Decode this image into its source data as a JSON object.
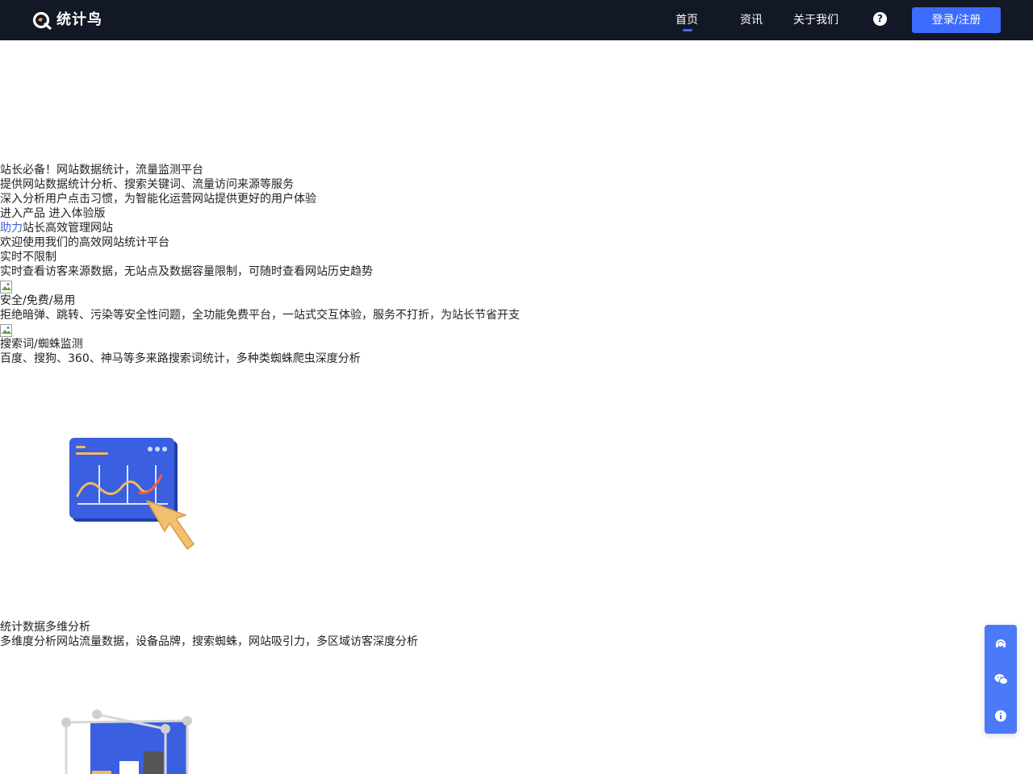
{
  "header": {
    "logo_text": "统计鸟",
    "nav": [
      {
        "label": "首页",
        "active": true
      },
      {
        "label": "资讯",
        "active": false
      },
      {
        "label": "关于我们",
        "active": false
      }
    ],
    "help_icon": "question-circle-icon",
    "help_glyph": "?",
    "login_label": "登录/注册",
    "accent_color": "#3d6bfc",
    "bar_color": "#131826"
  },
  "hero": {
    "title": "站长必备！网站数据统计，流量监测平台",
    "subtitle1": "提供网站数据统计分析、搜索关键词、流量访问来源等服务",
    "subtitle2": "深入分析用户点击习惯，为智能化运营网站提供更好的用户体验",
    "btn_product": "进入产品",
    "btn_demo": "进入体验版"
  },
  "section": {
    "heading_accent": "助力",
    "heading_rest": "站长高效管理网站",
    "intro": "欢迎使用我们的高效网站统计平台"
  },
  "features": [
    {
      "title": "实时不限制",
      "desc": "实时查看访客来源数据，无站点及数据容量限制，可随时查看网站历史趋势"
    },
    {
      "title": "安全/免费/易用",
      "desc": "拒绝暗弹、跳转、污染等安全性问题，全功能免费平台，一站式交互体验，服务不打折，为站长节省开支"
    },
    {
      "title": "搜索词/蜘蛛监测",
      "desc": "百度、搜狗、360、神马等多来路搜索词统计，多种类蜘蛛爬虫深度分析"
    }
  ],
  "analysis": {
    "title": "统计数据多维分析",
    "desc": "多维度分析网站流量数据，设备品牌，搜索蜘蛛，网站吸引力，多区域访客深度分析"
  },
  "float_bar": {
    "items": [
      "customer-service-icon",
      "wechat-icon",
      "info-icon"
    ]
  }
}
